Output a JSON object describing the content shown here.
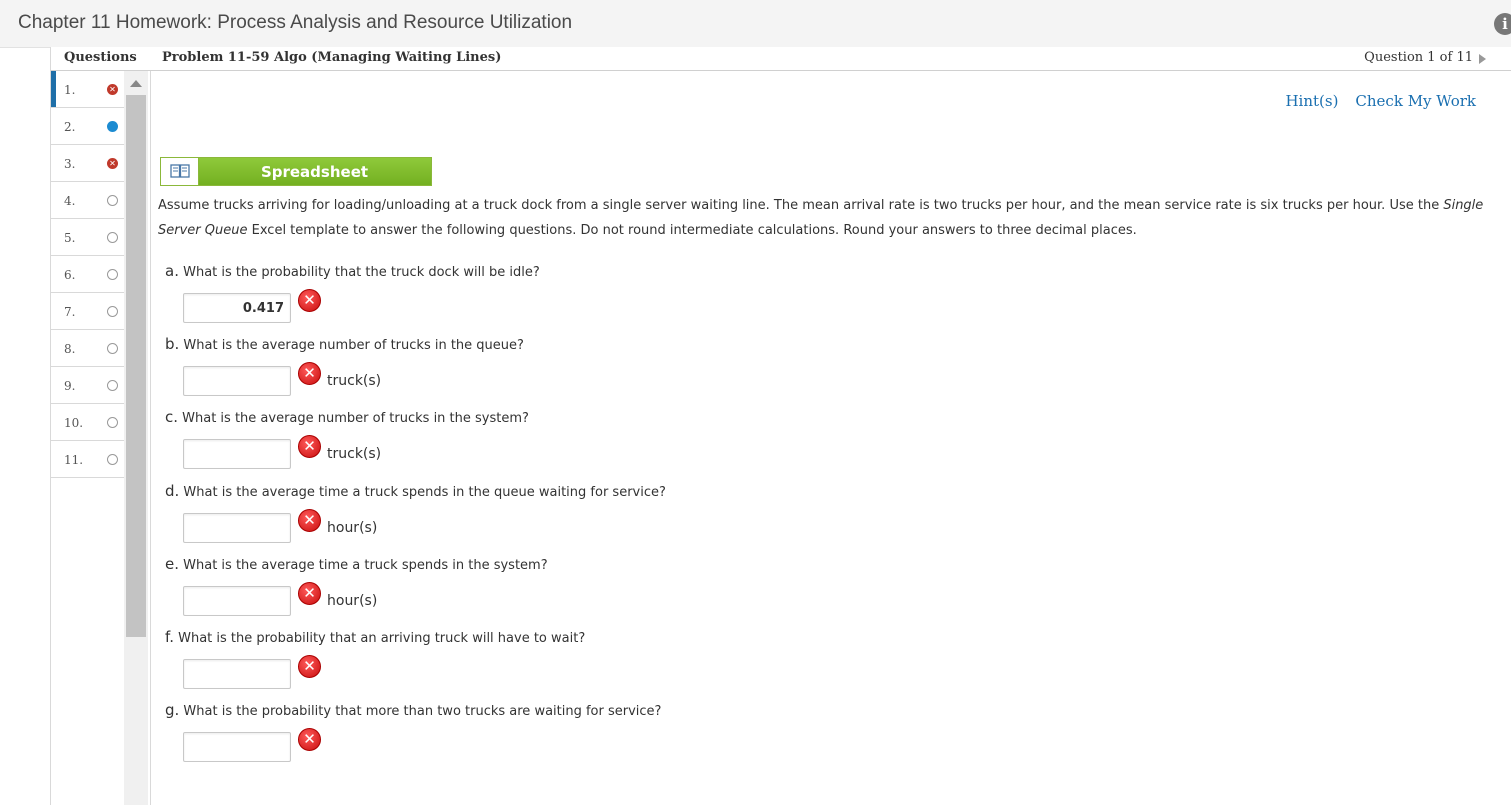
{
  "window": {
    "title": "Chapter 11 Homework: Process Analysis and Resource Utilization"
  },
  "header": {
    "questions_label": "Questions",
    "problem_title": "Problem 11-59 Algo (Managing Waiting Lines)",
    "question_position": "Question 1 of 11"
  },
  "sidebar": {
    "items": [
      {
        "label": "1.",
        "status": "incorrect"
      },
      {
        "label": "2.",
        "status": "current"
      },
      {
        "label": "3.",
        "status": "incorrect"
      },
      {
        "label": "4.",
        "status": "unanswered"
      },
      {
        "label": "5.",
        "status": "unanswered"
      },
      {
        "label": "6.",
        "status": "unanswered"
      },
      {
        "label": "7.",
        "status": "unanswered"
      },
      {
        "label": "8.",
        "status": "unanswered"
      },
      {
        "label": "9.",
        "status": "unanswered"
      },
      {
        "label": "10.",
        "status": "unanswered"
      },
      {
        "label": "11.",
        "status": "unanswered"
      }
    ]
  },
  "links": {
    "hint": "Hint(s)",
    "check": "Check My Work"
  },
  "spreadsheet": {
    "label": "Spreadsheet",
    "icon": "book-icon"
  },
  "intro": {
    "part1": "Assume trucks arriving for loading/unloading at a truck dock from a single server waiting line. The mean arrival rate is two trucks per hour, and the mean service rate is six trucks per hour. Use the ",
    "emph": "Single Server Queue",
    "part2": " Excel template to answer the following questions. Do not round intermediate calculations. Round your answers to three decimal places."
  },
  "parts": [
    {
      "letter": "a.",
      "text": " What is the probability that the truck dock will be idle?",
      "value": "0.417",
      "unit": ""
    },
    {
      "letter": "b.",
      "text": " What is the average number of trucks in the queue?",
      "value": "",
      "unit": "truck(s)"
    },
    {
      "letter": "c.",
      "text": " What is the average number of trucks in the system?",
      "value": "",
      "unit": "truck(s)"
    },
    {
      "letter": "d.",
      "text": " What is the average time a truck spends in the queue waiting for service?",
      "value": "",
      "unit": "hour(s)"
    },
    {
      "letter": "e.",
      "text": " What is the average time a truck spends in the system?",
      "value": "",
      "unit": "hour(s)"
    },
    {
      "letter": "f.",
      "text": " What is the probability that an arriving truck will have to wait?",
      "value": "",
      "unit": ""
    },
    {
      "letter": "g.",
      "text": " What is the probability that more than two trucks are waiting for service?",
      "value": "",
      "unit": ""
    }
  ],
  "colors": {
    "link": "#1a6fb0",
    "incorrect": "#c0392b",
    "current": "#1c8bd1",
    "spreadsheet": "#7dbb2b"
  }
}
